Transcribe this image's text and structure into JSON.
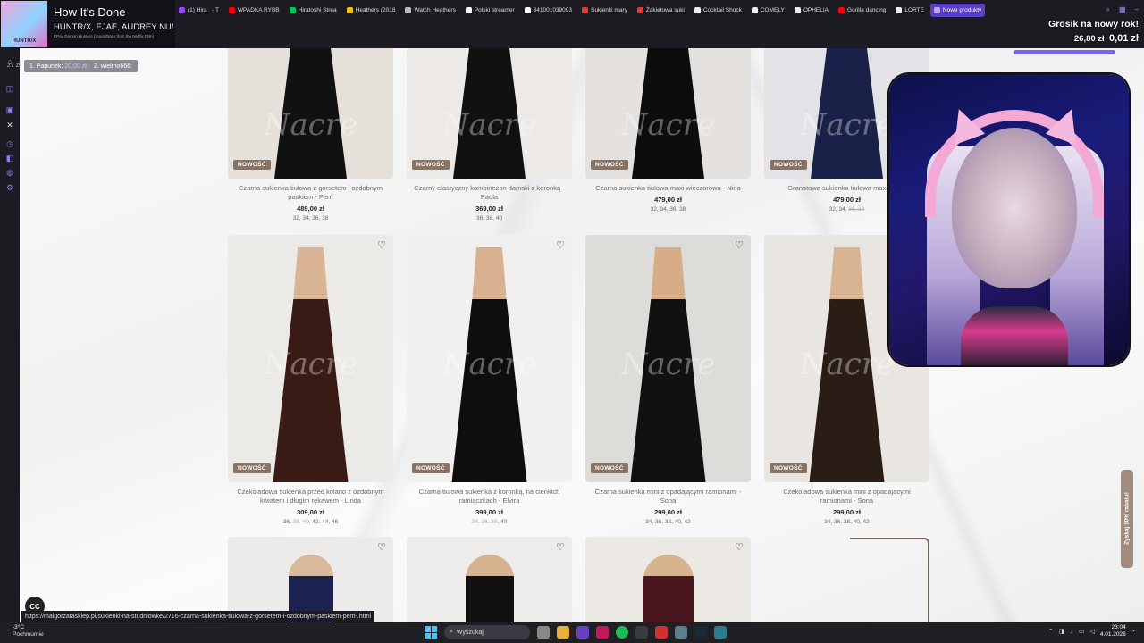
{
  "music": {
    "album_art_text": "HUNTR/X",
    "title": "How It's Done",
    "artist": "HUNTR/X, EJAE, AUDREY NUNA, ...",
    "subtitle": "KPop Demon Hunters (Soundtrack from the Netflix Film)"
  },
  "tabs": [
    {
      "label": "(1) Hira_ - T",
      "color": "#9146ff"
    },
    {
      "label": "WPADKA RYBB",
      "color": "#ff0000"
    },
    {
      "label": "Hiratoshi Strea",
      "color": "#00c853"
    },
    {
      "label": "Heathers (2018",
      "color": "#f5c400"
    },
    {
      "label": "Watch Heathers",
      "color": "#bbbbbb"
    },
    {
      "label": "Polski streamer",
      "color": "#ffffff"
    },
    {
      "label": "341001039093",
      "color": "#ffffff"
    },
    {
      "label": "Sukienki mary",
      "color": "#e53935"
    },
    {
      "label": "Żakietowa suki",
      "color": "#e53935"
    },
    {
      "label": "Cocktail Shock",
      "color": "#eeeeee"
    },
    {
      "label": "COMELY",
      "color": "#eeeeee"
    },
    {
      "label": "OPHELIA",
      "color": "#eeeeee"
    },
    {
      "label": "Gorilla dancing",
      "color": "#ff0000"
    },
    {
      "label": "LORTE",
      "color": "#eeeeee"
    },
    {
      "label": "Nowe produkty",
      "color": "#c9a0ff",
      "active": true
    }
  ],
  "donation": {
    "title": "Grosik na nowy rok!",
    "collected": "26,80 zł",
    "current": "0,01 zł"
  },
  "leaderboard": {
    "first_prefix": "1. Papunek:",
    "first_value": "20,00 zł",
    "second": "2. wielmo666:"
  },
  "counter": "27 zł",
  "products_row1": [
    {
      "name": "Czarna sukienka tiulowa z gorsetem i ozdobnym paskiem - Perri",
      "price": "489,00 zł",
      "sizes": "32, 34, 36, 38",
      "badge": "NOWOŚĆ"
    },
    {
      "name": "Czarny elastyczny kombinezon damski z koronką - Paola",
      "price": "369,00 zł",
      "sizes": "36, 38, 40",
      "badge": "NOWOŚĆ"
    },
    {
      "name": "Czarna sukienka tiulowa maxi wieczorowa - Nina",
      "price": "479,00 zł",
      "sizes": "32, 34, 36, 38",
      "badge": "NOWOŚĆ"
    },
    {
      "name": "Granatowa sukienka tiulowa maxi wiecz",
      "price": "479,00 zł",
      "sizes": "32, 34, ",
      "sizes_struck": "36, 38",
      "badge": "NOWOŚĆ"
    }
  ],
  "products_row2": [
    {
      "name": "Czekoladowa sukienka przed kolano z ozdobnym kwiatem i długim rękawem - Linda",
      "price": "309,00 zł",
      "sizes": "36, ",
      "sizes_struck": "38, 40,",
      "sizes_rest": " 42, 44, 46",
      "badge": "NOWOŚĆ"
    },
    {
      "name": "Czarna tiulowa sukienka z koronką, na cienkich ramiączkach - Elvira",
      "price": "399,00 zł",
      "sizes": "",
      "sizes_struck": "34, 36, 38,",
      "sizes_rest": " 40",
      "badge": "NOWOŚĆ"
    },
    {
      "name": "Czarna sukienka mini z opadającymi ramionami - Sona",
      "price": "299,00 zł",
      "sizes": "34, 36, 38, 40, 42",
      "badge": "NOWOŚĆ"
    },
    {
      "name": "Czekoladowa sukienka mini z opadającymi ramionami - Sona",
      "price": "299,00 zł",
      "sizes": "34, 36, 38, 40, 42",
      "badge": "NOWOŚĆ"
    }
  ],
  "watermark": "Nacre",
  "side_tab": "Zyskaj 10% rabatu!",
  "status_url": "https://malgorzatasklep.pl/sukienki-na-studniowke/2716-czarna-sukienka-tiulowa-z-gorsetem-i-ozdobnym-paskiem-perri-.html",
  "cc_label": "CC",
  "taskbar": {
    "temp": "-3°C",
    "weather": "Pochmurnie",
    "search_placeholder": "Wyszukaj",
    "time": "23:04",
    "date": "4.01.2026"
  }
}
